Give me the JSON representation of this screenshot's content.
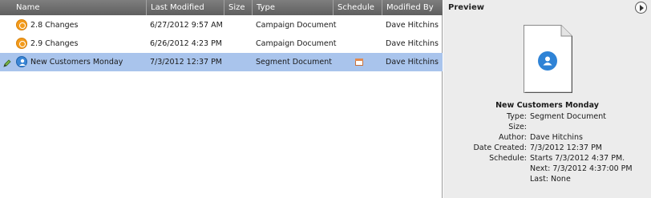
{
  "columns": {
    "name": "Name",
    "last_modified": "Last Modified",
    "size": "Size",
    "type": "Type",
    "schedule": "Schedule",
    "modified_by": "Modified By"
  },
  "rows": [
    {
      "icon": "campaign-document-icon",
      "name": "2.8 Changes",
      "last_modified": "6/27/2012 9:57 AM",
      "type": "Campaign Document",
      "modified_by": "Dave Hitchins",
      "selected": false
    },
    {
      "icon": "campaign-document-icon",
      "name": "2.9 Changes",
      "last_modified": "6/26/2012 4:23 PM",
      "type": "Campaign Document",
      "modified_by": "Dave Hitchins",
      "selected": false
    },
    {
      "icon": "segment-document-icon",
      "name": "New Customers Monday",
      "last_modified": "7/3/2012 12:37 PM",
      "type": "Segment Document",
      "modified_by": "Dave Hitchins",
      "selected": true,
      "has_schedule": true,
      "editing": true
    }
  ],
  "preview": {
    "title": "Preview",
    "doc_name": "New Customers Monday",
    "fields": [
      {
        "key": "Type:",
        "value": "Segment Document"
      },
      {
        "key": "Size:",
        "value": ""
      },
      {
        "key": "Author:",
        "value": "Dave Hitchins"
      },
      {
        "key": "Date Created:",
        "value": "7/3/2012 12:37 PM"
      },
      {
        "key": "Schedule:",
        "value": "Starts 7/3/2012 4:37 PM."
      },
      {
        "key": "",
        "value": "Next: 7/3/2012 4:37:00 PM"
      },
      {
        "key": "",
        "value": "Last: None"
      }
    ]
  },
  "colors": {
    "header": "#6f6f6f",
    "selected_row": "#a9c4ec",
    "campaign_icon": "#f39b1c",
    "segment_icon": "#3a86d6",
    "preview_bg": "#ececec"
  }
}
